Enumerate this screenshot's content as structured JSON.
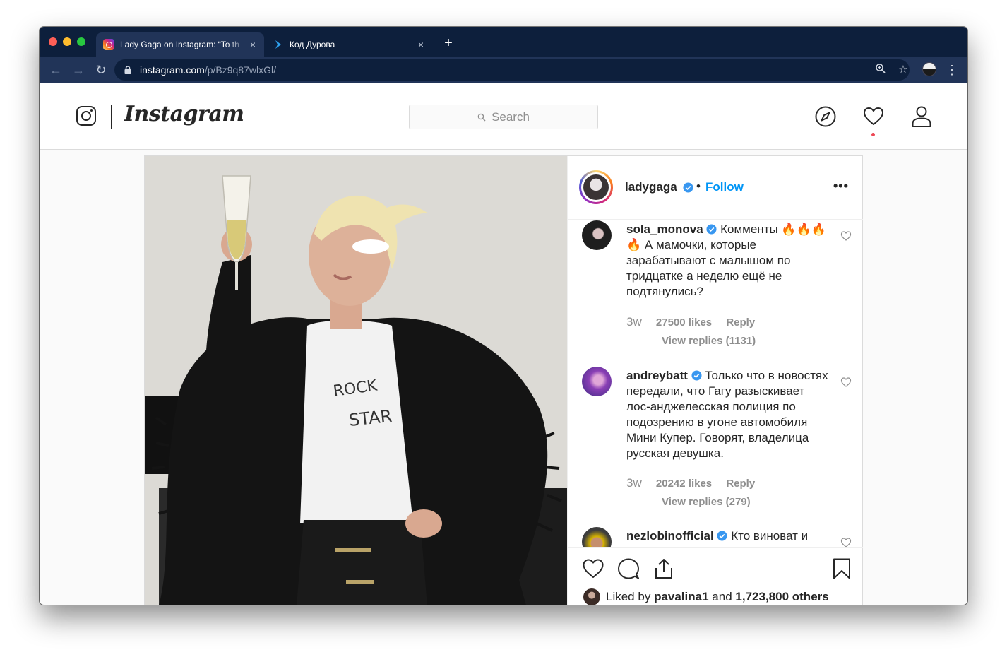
{
  "browser": {
    "tabs": [
      {
        "title": "Lady Gaga on Instagram: “To th",
        "favicon": "instagram-icon",
        "active": true
      },
      {
        "title": "Код Дурова",
        "favicon": "kod-durova-icon",
        "active": false
      }
    ],
    "url": {
      "host": "instagram.com",
      "path": "/p/Bz9q87wlxGl/"
    },
    "new_tab_label": "+",
    "close_glyph": "×"
  },
  "instagram": {
    "wordmark": "Instagram",
    "search_placeholder": "Search",
    "accent_color": "#0095f6"
  },
  "post": {
    "owner": {
      "username": "ladygaga",
      "verified": true,
      "separator": "•",
      "follow_label": "Follow"
    },
    "more_label": "•••",
    "comments": [
      {
        "username": "sola_monova",
        "verified": true,
        "text": "Комменты 🔥🔥🔥🔥 А мамочки, которые зарабатывают с малышом по тридцатке а неделю ещё не подтянулись?",
        "age": "3w",
        "likes": "27500 likes",
        "reply_label": "Reply",
        "view_replies": "View replies (1131)"
      },
      {
        "username": "andreybatt",
        "verified": true,
        "text": "Только что в новостях передали, что Гагу разыскивает лос-анджелесская полиция по подозрению в угоне автомобиля Мини Купер. Говорят, владелица русская девушка.",
        "age": "3w",
        "likes": "20242 likes",
        "reply_label": "Reply",
        "view_replies": "View replies (279)"
      },
      {
        "username": "nezlobinofficial",
        "verified": true,
        "text": "Кто виноват и"
      }
    ],
    "liked_by": {
      "prefix": "Liked by",
      "user": "pavalina1",
      "joiner": "and",
      "others": "1,723,800 others"
    }
  }
}
